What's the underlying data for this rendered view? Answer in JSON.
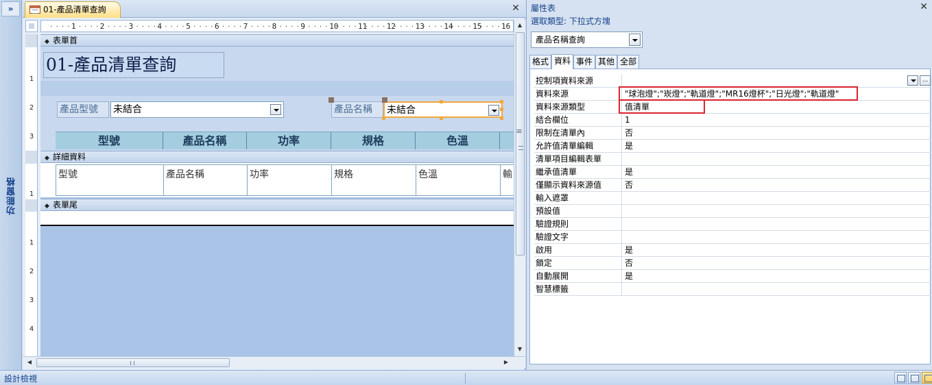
{
  "nav_pane": {
    "toggle_label": "»",
    "label": "功能窗格"
  },
  "doc_tab": {
    "title": "01-產品清單查詢",
    "close_label": "✕"
  },
  "ruler": {
    "marks": [
      "1",
      "2",
      "3",
      "4",
      "5",
      "6",
      "7",
      "8",
      "9",
      "10",
      "11",
      "12",
      "13",
      "14",
      "15",
      "16"
    ]
  },
  "vruler": {
    "header_marks": [
      "1",
      "2",
      "3"
    ],
    "detail_marks": [
      "1"
    ],
    "footer_marks": [
      "1",
      "2",
      "3",
      "4"
    ]
  },
  "form": {
    "header_section": "表單首",
    "detail_section": "詳細資料",
    "footer_section": "表單尾",
    "title": "01-產品清單查詢",
    "model_label": "產品型號",
    "model_value": "未結合",
    "name_label": "產品名稱",
    "name_value": "未結合",
    "header_columns": [
      "型號",
      "產品名稱",
      "功率",
      "規格",
      "色溫"
    ],
    "detail_columns": [
      "型號",
      "產品名稱",
      "功率",
      "規格",
      "色溫",
      "輸"
    ]
  },
  "property_sheet": {
    "title": "屬性表",
    "close_label": "✕",
    "selection_type": "選取類型: 下拉式方塊",
    "selected_object": "產品名稱查詢",
    "tabs": [
      "格式",
      "資料",
      "事件",
      "其他",
      "全部"
    ],
    "active_tab": "資料",
    "properties": [
      {
        "name": "控制項資料來源",
        "value": ""
      },
      {
        "name": "資料來源",
        "value": "\"球泡燈\";\"崁燈\";\"軌道燈\";\"MR16燈杯\";\"日光燈\";\"軌道燈\""
      },
      {
        "name": "資料來源類型",
        "value": "值清單"
      },
      {
        "name": "結合欄位",
        "value": "1"
      },
      {
        "name": "限制在清單內",
        "value": "否"
      },
      {
        "name": "允許值清單編輯",
        "value": "是"
      },
      {
        "name": "清單項目編輯表單",
        "value": ""
      },
      {
        "name": "繼承值清單",
        "value": "是"
      },
      {
        "name": "僅顯示資料來源值",
        "value": "否"
      },
      {
        "name": "輸入遮罩",
        "value": ""
      },
      {
        "name": "預設值",
        "value": ""
      },
      {
        "name": "驗證規則",
        "value": ""
      },
      {
        "name": "驗證文字",
        "value": ""
      },
      {
        "name": "啟用",
        "value": "是"
      },
      {
        "name": "鎖定",
        "value": "否"
      },
      {
        "name": "自動展開",
        "value": "是"
      },
      {
        "name": "智慧標籤",
        "value": ""
      }
    ],
    "builder_button": "..."
  },
  "status_bar": {
    "text": "設計檢視"
  },
  "colors": {
    "accent": "#15428b",
    "selection": "#f2a83a",
    "highlight": "#d9232e",
    "tab_active": "#ffdf87"
  }
}
